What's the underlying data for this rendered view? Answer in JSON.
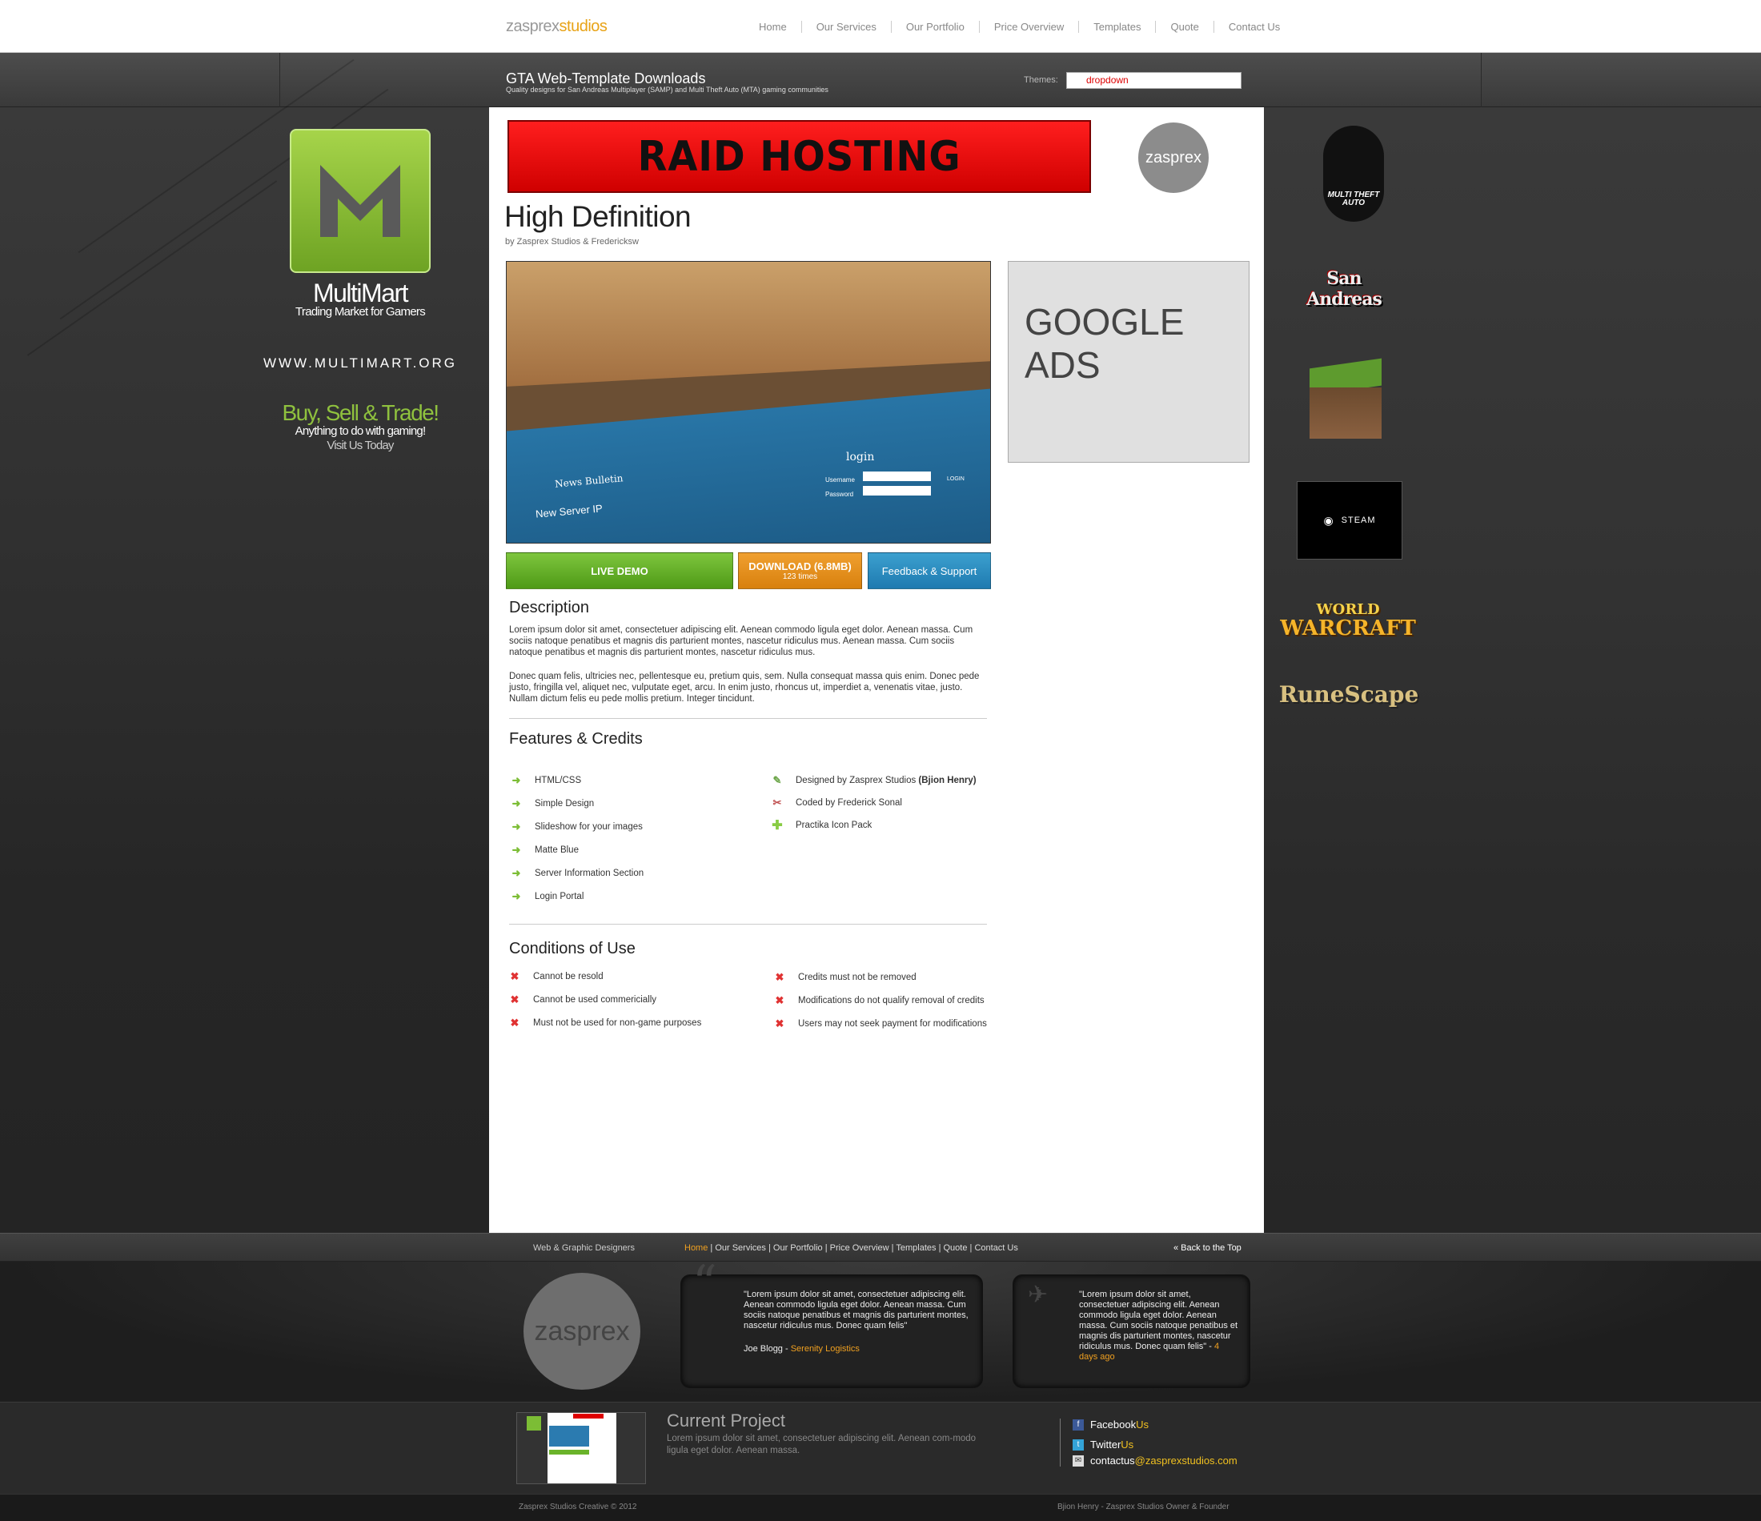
{
  "brand": {
    "logo_main": "zasprex",
    "logo_accent": "studios"
  },
  "nav": [
    "Home",
    "Our Services",
    "Our Portfolio",
    "Price Overview",
    "Templates",
    "Quote",
    "Contact Us"
  ],
  "header": {
    "title": "GTA Web-Template Downloads",
    "subtitle": "Quality designs for San Andreas Multiplayer (SAMP) and Multi Theft Auto (MTA) gaming communities",
    "themes_label": "Themes:",
    "themes_value": "dropdown"
  },
  "left_ad": {
    "name": "MultiMart",
    "tagline": "Trading Market for Gamers",
    "url": "WWW.MULTIMART.ORG",
    "slogan": "Buy, Sell & Trade!",
    "line2": "Anything to do with gaming!",
    "line3": "Visit Us Today"
  },
  "banner": {
    "text": "RAID HOSTING",
    "circle_logo": "zasprex"
  },
  "product": {
    "title": "High Definition",
    "byline": "by Zasprex Studios & Fredericksw",
    "screenshot": {
      "news": "News Bulletin",
      "server": "New Server IP",
      "login": "login",
      "username": "Username",
      "password": "Password",
      "login_btn": "LOGIN"
    },
    "buttons": {
      "live": "LIVE DEMO",
      "download": "DOWNLOAD (6.8MB)",
      "download_count": "123 times",
      "feedback": "Feedback & Support"
    }
  },
  "google_ads": "GOOGLE ADS",
  "description": {
    "heading": "Description",
    "p1": "Lorem ipsum dolor sit amet, consectetuer adipiscing elit. Aenean commodo ligula eget dolor. Aenean massa. Cum sociis natoque penatibus et magnis dis parturient montes, nascetur ridiculus mus. Aenean massa. Cum sociis natoque penatibus et magnis dis parturient montes, nascetur ridiculus mus.",
    "p2": "Donec quam felis, ultricies nec, pellentesque eu, pretium quis, sem. Nulla consequat massa quis enim. Donec pede justo, fringilla vel, aliquet nec, vulputate eget, arcu. In enim justo, rhoncus ut, imperdiet a, venenatis vitae, justo. Nullam dictum felis eu pede mollis pretium. Integer tincidunt."
  },
  "features": {
    "heading": "Features & Credits",
    "items": [
      "HTML/CSS",
      "Simple Design",
      "Slideshow for your images",
      "Matte Blue",
      "Server Information Section",
      "Login Portal"
    ],
    "credit_designed": "Designed by Zasprex Studios",
    "credit_designer": "(Bjion Henry)",
    "credit_coded": "Coded by Frederick Sonal",
    "credit_icons": "Practika Icon Pack"
  },
  "conditions": {
    "heading": "Conditions of Use",
    "left": [
      "Cannot be resold",
      "Cannot be used commericially",
      "Must not be used for non-game purposes"
    ],
    "right": [
      "Credits must not be removed",
      "Modifications do not qualify removal of credits",
      "Users may not seek payment for modifications"
    ]
  },
  "right_logos": [
    "MULTI THEFT AUTO",
    "San Andreas",
    "STEAM",
    "WORLD",
    "WARCRAFT",
    "RuneScape"
  ],
  "footer": {
    "tagline": "Web & Graphic Designers",
    "links": [
      "Home",
      "Our Services",
      "Our Portfolio",
      "Price Overview",
      "Templates",
      "Quote",
      "Contact Us"
    ],
    "back_top": "« Back to the Top",
    "logo": "zasprex",
    "quote1": "\"Lorem ipsum dolor sit amet, consectetuer adipiscing elit. Aenean commodo ligula eget dolor. Aenean massa. Cum sociis natoque penatibus et magnis dis parturient montes, nascetur ridiculus mus. Donec quam felis\"",
    "quote1_author": "Joe Blogg - ",
    "quote1_org": "Serenity Logistics",
    "quote2": "\"Lorem ipsum dolor sit amet, consectetuer adipiscing elit. Aenean commodo ligula eget dolor. Aenean massa. Cum sociis natoque penatibus et magnis dis parturient montes, nascetur ridiculus mus. Donec quam felis\" - ",
    "quote2_time": "4 days ago",
    "current_title": "Current Project",
    "current_text": "Lorem ipsum dolor sit amet, consectetuer adipiscing elit. Aenean com-modo ligula eget dolor. Aenean massa.",
    "facebook": "Facebook",
    "facebook_us": "Us",
    "twitter": "Twitter",
    "twitter_us": "Us",
    "contact": "contactus",
    "contact_domain": "@zasprexstudios.com",
    "copyright": "Zasprex Studios Creative  © 2012",
    "founder": "Bjion Henry - Zasprex Studios Owner & Founder"
  }
}
